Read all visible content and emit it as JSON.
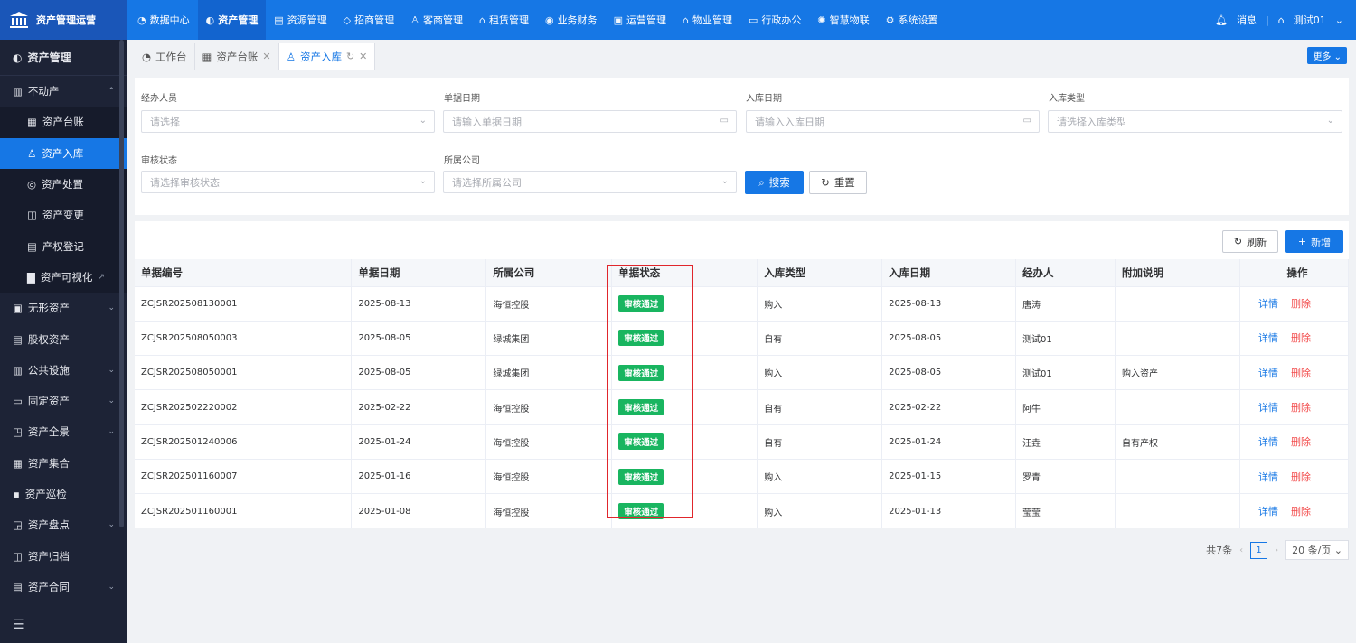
{
  "app": {
    "title": "资产管理运营"
  },
  "topnav": [
    {
      "label": "数据中心",
      "icon": "◔"
    },
    {
      "label": "资产管理",
      "icon": "◐"
    },
    {
      "label": "资源管理",
      "icon": "▤"
    },
    {
      "label": "招商管理",
      "icon": "◇"
    },
    {
      "label": "客商管理",
      "icon": "♙"
    },
    {
      "label": "租赁管理",
      "icon": "⌂"
    },
    {
      "label": "业务财务",
      "icon": "◉"
    },
    {
      "label": "运营管理",
      "icon": "▣"
    },
    {
      "label": "物业管理",
      "icon": "⌂"
    },
    {
      "label": "行政办公",
      "icon": "▭"
    },
    {
      "label": "智慧物联",
      "icon": "✺"
    },
    {
      "label": "系统设置",
      "icon": "⚙"
    }
  ],
  "top_right": {
    "messages": "消息",
    "user": "测试01"
  },
  "sidebar": {
    "header": "资产管理",
    "items": [
      {
        "label": "不动产",
        "icon": "▥",
        "chev": "⌃"
      },
      {
        "label": "资产台账",
        "icon": "▦"
      },
      {
        "label": "资产入库",
        "icon": "♙"
      },
      {
        "label": "资产处置",
        "icon": "◎"
      },
      {
        "label": "资产变更",
        "icon": "◫"
      },
      {
        "label": "产权登记",
        "icon": "▤"
      },
      {
        "label": "资产可视化",
        "icon": "▇"
      },
      {
        "label": "无形资产",
        "icon": "▣",
        "chev": "⌄"
      },
      {
        "label": "股权资产",
        "icon": "▤"
      },
      {
        "label": "公共设施",
        "icon": "▥",
        "chev": "⌄"
      },
      {
        "label": "固定资产",
        "icon": "▭",
        "chev": "⌄"
      },
      {
        "label": "资产全景",
        "icon": "◳",
        "chev": "⌄"
      },
      {
        "label": "资产集合",
        "icon": "▦"
      },
      {
        "label": "资产巡检",
        "icon": "▪"
      },
      {
        "label": "资产盘点",
        "icon": "◲",
        "chev": "⌄"
      },
      {
        "label": "资产归档",
        "icon": "◫"
      },
      {
        "label": "资产合同",
        "icon": "▤",
        "chev": "⌄"
      }
    ]
  },
  "tabs": [
    {
      "label": "工作台",
      "icon": "◔"
    },
    {
      "label": "资产台账",
      "icon": "▦",
      "close": "✕"
    },
    {
      "label": "资产入库",
      "icon": "♙",
      "refresh": "↻",
      "close": "✕"
    }
  ],
  "more_button": "更多 ⌄",
  "filters": {
    "handler": {
      "label": "经办人员",
      "placeholder": "请选择"
    },
    "doc_date": {
      "label": "单据日期",
      "placeholder": "请输入单据日期"
    },
    "in_date": {
      "label": "入库日期",
      "placeholder": "请输入入库日期"
    },
    "in_type": {
      "label": "入库类型",
      "placeholder": "请选择入库类型"
    },
    "audit": {
      "label": "审核状态",
      "placeholder": "请选择审核状态"
    },
    "company": {
      "label": "所属公司",
      "placeholder": "请选择所属公司"
    },
    "search": "搜索",
    "reset": "重置"
  },
  "table_actions": {
    "refresh": "刷新",
    "add": "新增"
  },
  "table": {
    "headers": [
      "单据编号",
      "单据日期",
      "所属公司",
      "单据状态",
      "入库类型",
      "入库日期",
      "经办人",
      "附加说明",
      "操作"
    ],
    "rows": [
      [
        "ZCJSR202508130001",
        "2025-08-13",
        "海恒控股",
        "审核通过",
        "购入",
        "2025-08-13",
        "唐涛",
        ""
      ],
      [
        "ZCJSR202508050003",
        "2025-08-05",
        "绿城集团",
        "审核通过",
        "自有",
        "2025-08-05",
        "测试01",
        ""
      ],
      [
        "ZCJSR202508050001",
        "2025-08-05",
        "绿城集团",
        "审核通过",
        "购入",
        "2025-08-05",
        "测试01",
        "购入资产"
      ],
      [
        "ZCJSR202502220002",
        "2025-02-22",
        "海恒控股",
        "审核通过",
        "自有",
        "2025-02-22",
        "阿牛",
        ""
      ],
      [
        "ZCJSR202501240006",
        "2025-01-24",
        "海恒控股",
        "审核通过",
        "自有",
        "2025-01-24",
        "汪垚",
        "自有产权"
      ],
      [
        "ZCJSR202501160007",
        "2025-01-16",
        "海恒控股",
        "审核通过",
        "购入",
        "2025-01-15",
        "罗青",
        ""
      ],
      [
        "ZCJSR202501160001",
        "2025-01-08",
        "海恒控股",
        "审核通过",
        "购入",
        "2025-01-13",
        "莹莹",
        ""
      ]
    ],
    "detail": "详情",
    "delete": "删除"
  },
  "pager": {
    "total": "共7条",
    "page": "1",
    "size": "20 条/页"
  },
  "colors": {
    "primary": "#1677e5",
    "sidebar": "#1d2336",
    "success": "#19b560",
    "danger": "#f24848",
    "highlight": "#e0262c"
  }
}
